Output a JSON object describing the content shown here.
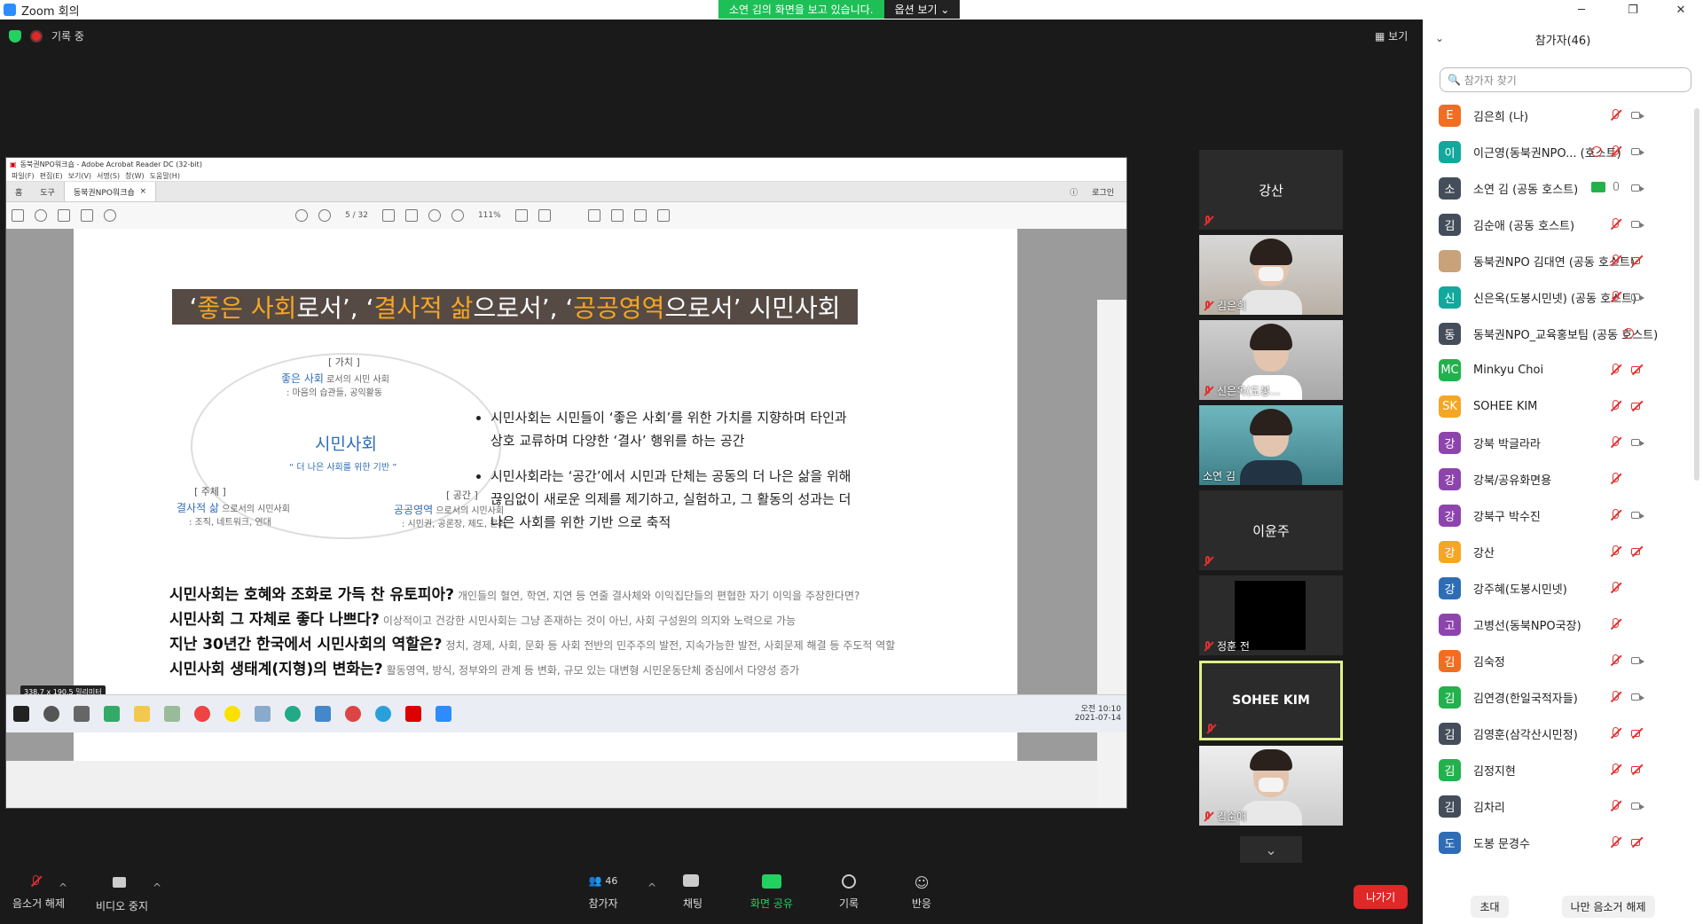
{
  "window": {
    "title": "Zoom 회의"
  },
  "share_banner": {
    "message": "소연 김의 화면을 보고 있습니다.",
    "options_label": "옵션 보기"
  },
  "status": {
    "recording_label": "기록 중",
    "view_label": "보기"
  },
  "shared_screen": {
    "app_title": "동북권NPO워크숍 - Adobe Acrobat Reader DC (32-bit)",
    "menu": [
      "파일(F)",
      "편집(E)",
      "보기(V)",
      "서명(S)",
      "창(W)",
      "도움말(H)"
    ],
    "tabs": [
      "홈",
      "도구",
      "동북권NPO워크숍"
    ],
    "login_label": "로그인",
    "page_indicator": "5 / 32",
    "zoom": "111%",
    "dimension_tag": "338.7 x 190.5 밀리미터",
    "clock_time": "오전 10:10",
    "clock_date": "2021-07-14",
    "slide": {
      "title_parts": [
        "‘",
        "좋은 사회",
        "로서’, ‘",
        "결사적 삶",
        "으로서’, ‘",
        "공공영역",
        "으로서’ 시민사회"
      ],
      "diagram": {
        "value_head": "[ 가치 ]",
        "value_line1_em": "좋은 사회",
        "value_line1_rest": " 로서의 시민 사회",
        "value_line2": ": 마음의 습관들, 공익활동",
        "center_title": "시민사회",
        "center_sub": "“ 더 나은 사회를 위한 기반 ”",
        "subject_head": "[ 주체 ]",
        "subject_line1_em": "결사적 삶",
        "subject_line1_rest": " 으로서의 시민사회",
        "subject_line2": ": 조직, 네트워크, 연대",
        "space_head": "[ 공간 ]",
        "space_line1_em": "공공영역",
        "space_line1_rest": " 으로서의 시민사회",
        "space_line2": ": 시민권, 공론장, 제도, 문화"
      },
      "bullets": [
        "시민사회는 시민들이 ‘좋은 사회’를 위한 가치를 지향하며 타인과 상호 교류하며 다양한 ‘결사’ 행위를 하는 공간",
        "시민사회라는 ‘공간’에서 시민과 단체는 공동의 더 나은 삶을 위해 끊임없이 새로운 의제를 제기하고, 실험하고, 그 활동의 성과는 더 나은 사회를 위한 기반 으로 축적"
      ],
      "questions": [
        {
          "q": "시민사회는 호혜와 조화로 가득 찬 유토피아?",
          "sub": "개인들의 혈연, 학연, 지연 등 연줄 결사체와 이익집단들의 편협한 자기 이익을 주장한다면?"
        },
        {
          "q": "시민사회 그 자체로 좋다 나쁘다?",
          "sub": "이상적이고 건강한 시민사회는 그냥 존재하는 것이 아닌, 사회 구성원의 의지와 노력으로 가능"
        },
        {
          "q": "지난 30년간 한국에서 시민사회의 역할은?",
          "sub": "정치, 경제, 사회, 문화 등 사회 전반의 민주주의 발전, 지속가능한 발전, 사회문제 해결 등 주도적 역할"
        },
        {
          "q": "시민사회 생태계(지형)의 변화는?",
          "sub": "활동영역, 방식, 정부와의 관계 등 변화, 규모 있는 대변형 시민운동단체 중심에서 다양성 증가"
        }
      ],
      "page_number": "5"
    }
  },
  "video_tiles": [
    {
      "name": "강산",
      "type": "name-only"
    },
    {
      "name": "김은희",
      "type": "camera"
    },
    {
      "name": "신은옥(도봉...",
      "type": "camera"
    },
    {
      "name": "소연 김",
      "type": "camera"
    },
    {
      "name": "이윤주",
      "type": "name-only"
    },
    {
      "name": "정훈 전",
      "type": "black"
    },
    {
      "name": "SOHEE KIM",
      "type": "active-speaker"
    },
    {
      "name": "김순애",
      "type": "camera"
    }
  ],
  "bottom_bar": {
    "unmute": "음소거 해제",
    "stop_video": "비디오 중지",
    "participants": "참가자",
    "participants_count": "46",
    "chat": "채팅",
    "share": "화면 공유",
    "record": "기록",
    "reactions": "반응",
    "leave": "나가기"
  },
  "panel": {
    "title": "참가자(46)",
    "search_placeholder": "참가자 찾기",
    "participants": [
      {
        "initial": "E",
        "color": "#f26d21",
        "name": "김은희 (나)",
        "mic": "muted",
        "cam": "on"
      },
      {
        "initial": "이",
        "color": "#13a89e",
        "name": "이근영(동북권NPO... (호스트)",
        "mic": "muted",
        "cam": "on",
        "rec": true
      },
      {
        "initial": "소",
        "color": "#444d5a",
        "name": "소연 김 (공동 호스트)",
        "mic": "on",
        "cam": "on",
        "share": true
      },
      {
        "initial": "김",
        "color": "#444d5a",
        "name": "김순애 (공동 호스트)",
        "mic": "muted",
        "cam": "on"
      },
      {
        "initial": "",
        "color": "#c9a27a",
        "name": "동북권NPO 김대연 (공동 호스트)",
        "mic": "muted",
        "cam": "muted"
      },
      {
        "initial": "신",
        "color": "#13a89e",
        "name": "신은옥(도봉시민넷) (공동 호스트)",
        "mic": "muted",
        "cam": "on"
      },
      {
        "initial": "동",
        "color": "#444d5a",
        "name": "동북권NPO_교육홍보팀 (공동 호스트)",
        "rec": true
      },
      {
        "initial": "MC",
        "color": "#23b14d",
        "name": "Minkyu Choi",
        "mic": "muted",
        "cam": "muted"
      },
      {
        "initial": "SK",
        "color": "#f5a623",
        "name": "SOHEE KIM",
        "mic": "muted",
        "cam": "muted"
      },
      {
        "initial": "강",
        "color": "#8e44ad",
        "name": "강북 박글라라",
        "mic": "muted",
        "cam": "on"
      },
      {
        "initial": "강",
        "color": "#8e44ad",
        "name": "강북/공유화면용",
        "mic": "muted"
      },
      {
        "initial": "강",
        "color": "#8e44ad",
        "name": "강북구 박수진",
        "mic": "muted",
        "cam": "on"
      },
      {
        "initial": "강",
        "color": "#f5a623",
        "name": "강산",
        "mic": "muted",
        "cam": "muted"
      },
      {
        "initial": "강",
        "color": "#2e6db4",
        "name": "강주혜(도봉시민넷)",
        "mic": "muted"
      },
      {
        "initial": "고",
        "color": "#8e44ad",
        "name": "고병선(동북NPO국장)",
        "mic": "muted"
      },
      {
        "initial": "김",
        "color": "#f26d21",
        "name": "김숙정",
        "mic": "muted",
        "cam": "on"
      },
      {
        "initial": "김",
        "color": "#23b14d",
        "name": "김연경(한일국적자들)",
        "mic": "muted",
        "cam": "on"
      },
      {
        "initial": "김",
        "color": "#444d5a",
        "name": "김영훈(삼각산시민정)",
        "mic": "muted",
        "cam": "muted"
      },
      {
        "initial": "김",
        "color": "#23b14d",
        "name": "김정지현",
        "mic": "muted",
        "cam": "muted"
      },
      {
        "initial": "김",
        "color": "#444d5a",
        "name": "김차리",
        "mic": "muted",
        "cam": "on"
      },
      {
        "initial": "도",
        "color": "#2e6db4",
        "name": "도봉 문경수",
        "mic": "muted",
        "cam": "muted"
      }
    ],
    "invite": "초대",
    "unmute_me": "나만 음소거 해제"
  }
}
